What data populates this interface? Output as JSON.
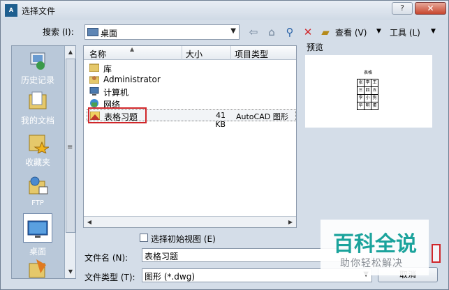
{
  "window": {
    "title": "选择文件",
    "app_icon_text": "AutoCAD",
    "help_label": "?",
    "close_label": "✕"
  },
  "toolbar": {
    "search_label": "搜索 (I):",
    "location": "桌面",
    "view_label": "查看 (V)",
    "tools_label": "工具 (L)",
    "icons": [
      "back-icon",
      "up-folder-icon",
      "search-web-icon",
      "delete-icon",
      "new-folder-icon"
    ]
  },
  "places": [
    {
      "label": "历史记录",
      "icon": "history-icon"
    },
    {
      "label": "我的文档",
      "icon": "documents-icon"
    },
    {
      "label": "收藏夹",
      "icon": "favorites-icon"
    },
    {
      "label": "FTP",
      "icon": "ftp-icon"
    },
    {
      "label": "桌面",
      "icon": "desktop-icon",
      "selected": true
    },
    {
      "label": "",
      "icon": "buzzsaw-icon"
    }
  ],
  "filelist": {
    "columns": [
      "名称",
      "大小",
      "项目类型"
    ],
    "rows": [
      {
        "name": "库",
        "size": "",
        "type": "",
        "icon": "library-icon"
      },
      {
        "name": "Administrator",
        "size": "",
        "type": "",
        "icon": "user-folder-icon"
      },
      {
        "name": "计算机",
        "size": "",
        "type": "",
        "icon": "computer-icon"
      },
      {
        "name": "网络",
        "size": "",
        "type": "",
        "icon": "network-icon"
      },
      {
        "name": "表格习题",
        "size": "41 KB",
        "type": "AutoCAD 图形",
        "icon": "dwg-file-icon",
        "selected": true
      }
    ]
  },
  "preview": {
    "label": "预览",
    "doc_title": "表格",
    "grid": [
      [
        "张",
        "李",
        "王"
      ],
      [
        "三",
        "四",
        "五"
      ],
      [
        "李",
        "小",
        "狗"
      ],
      [
        "华",
        "明",
        "蛋"
      ]
    ]
  },
  "options": {
    "initial_view_label": "选择初始视图 (E)",
    "initial_view_checked": false
  },
  "fields": {
    "filename_label": "文件名 (N):",
    "filename_value": "表格习题",
    "filetype_label": "文件类型 (T):",
    "filetype_value": "图形 (*.dwg)"
  },
  "buttons": {
    "cancel": "取消"
  },
  "watermark": {
    "main": "百科全说",
    "sub": "助你轻松解决"
  },
  "colors": {
    "accent_highlight": "#d0262a",
    "watermark": "#1ba39c"
  }
}
